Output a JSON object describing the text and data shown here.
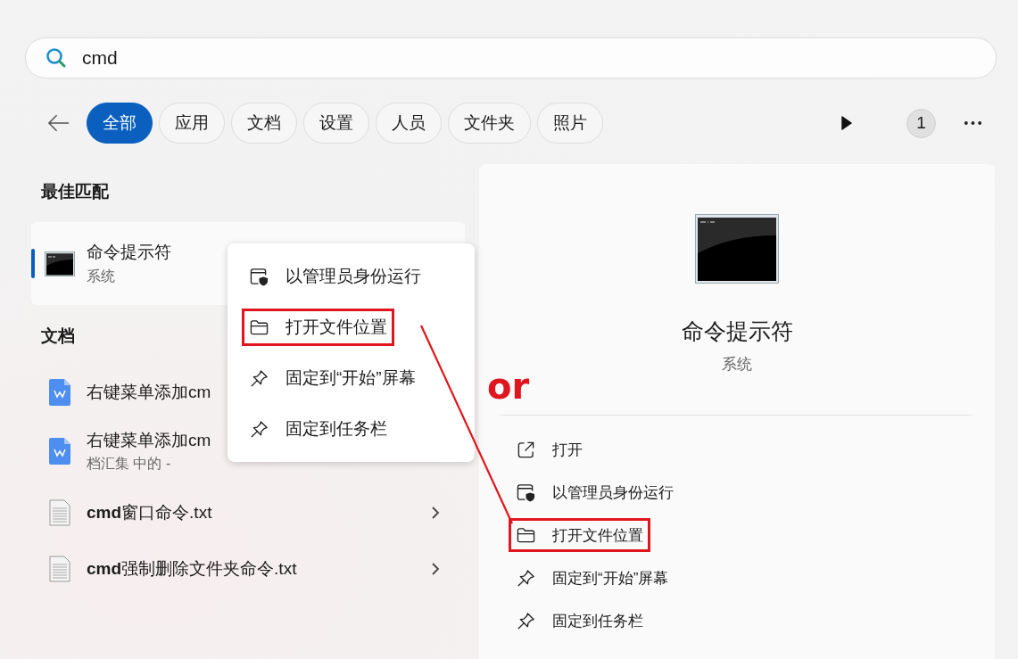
{
  "search": {
    "value": "cmd"
  },
  "filters": [
    {
      "label": "全部",
      "selected": true
    },
    {
      "label": "应用",
      "selected": false
    },
    {
      "label": "文档",
      "selected": false
    },
    {
      "label": "设置",
      "selected": false
    },
    {
      "label": "人员",
      "selected": false
    },
    {
      "label": "文件夹",
      "selected": false
    },
    {
      "label": "照片",
      "selected": false
    }
  ],
  "toolbar": {
    "badge": "1"
  },
  "best_match": {
    "heading": "最佳匹配",
    "title": "命令提示符",
    "subtitle": "系统",
    "selected": true
  },
  "documents": {
    "heading": "文档",
    "items": [
      {
        "kind": "word",
        "title": "右键菜单添加cm",
        "has_chevron": false
      },
      {
        "kind": "word",
        "title": "右键菜单添加cm",
        "subtitle": "档汇集 中的 -",
        "has_chevron": false
      },
      {
        "kind": "text",
        "title": "**cmd**窗口命令.txt",
        "has_chevron": true
      },
      {
        "kind": "text",
        "title": "**cmd**强制删除文件夹命令.txt",
        "has_chevron": true
      }
    ]
  },
  "context_menu": {
    "items": [
      {
        "kind": "admin",
        "label": "以管理员身份运行",
        "highlighted": false
      },
      {
        "kind": "folder",
        "label": "打开文件位置",
        "highlighted": true
      },
      {
        "kind": "pin",
        "label": "固定到“开始”屏幕",
        "highlighted": false
      },
      {
        "kind": "pin",
        "label": "固定到任务栏",
        "highlighted": false
      }
    ]
  },
  "detail": {
    "title": "命令提示符",
    "subtitle": "系统",
    "actions": [
      {
        "kind": "open",
        "label": "打开",
        "highlighted": false
      },
      {
        "kind": "admin",
        "label": "以管理员身份运行",
        "highlighted": false
      },
      {
        "kind": "folder",
        "label": "打开文件位置",
        "highlighted": true
      },
      {
        "kind": "pin",
        "label": "固定到“开始”屏幕",
        "highlighted": false
      },
      {
        "kind": "pin",
        "label": "固定到任务栏",
        "highlighted": false
      }
    ]
  },
  "annotation": {
    "text": "or"
  }
}
